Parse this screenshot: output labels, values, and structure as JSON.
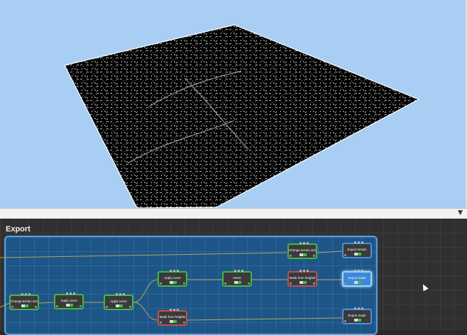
{
  "viewport": {
    "background_color": "#a9cef3",
    "terrain_fill": "#000000",
    "terrain_texture_color": "#f2f2f2"
  },
  "divider": {
    "chevron_icon": "chevron-down-icon"
  },
  "graph": {
    "group_title": "Export",
    "group_color": "#1f66a8",
    "nodes": [
      {
        "id": "n1",
        "label": "Change terrain size",
        "style": "green"
      },
      {
        "id": "n2",
        "label": "Apply curve",
        "style": "green"
      },
      {
        "id": "n3",
        "label": "Apply curve",
        "style": "green"
      },
      {
        "id": "n4",
        "label": "Apply curve",
        "style": "green"
      },
      {
        "id": "n5",
        "label": "Mask from heights",
        "style": "red"
      },
      {
        "id": "n6",
        "label": "Invert",
        "style": "green"
      },
      {
        "id": "n7",
        "label": "Mask from heights",
        "style": "red"
      },
      {
        "id": "n8",
        "label": "Change terrain size",
        "style": "green"
      },
      {
        "id": "n9",
        "label": "Export terrain",
        "style": "blue"
      },
      {
        "id": "n10",
        "label": "Export mask",
        "style": "selected"
      },
      {
        "id": "n11",
        "label": "Export mask",
        "style": "blue"
      }
    ]
  }
}
